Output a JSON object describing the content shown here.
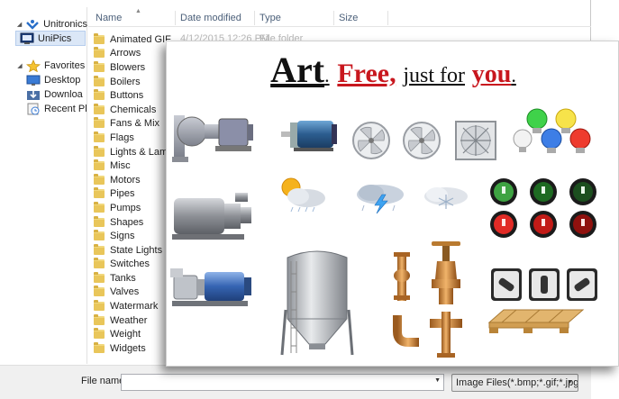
{
  "nav": {
    "items": [
      {
        "label": "Unitronics",
        "icon": "network-icon"
      },
      {
        "label": "UniPics",
        "icon": "monitor-icon"
      },
      {
        "label": "Favorites",
        "icon": "star-icon"
      },
      {
        "label": "Desktop",
        "icon": "desktop-icon"
      },
      {
        "label": "Downloa",
        "icon": "downloads-icon"
      },
      {
        "label": "Recent Pl",
        "icon": "recent-places-icon"
      }
    ]
  },
  "columns": {
    "name": "Name",
    "date_modified": "Date modified",
    "type": "Type",
    "size": "Size"
  },
  "first_row_detail": {
    "date": "4/12/2015 12:26 PM",
    "type": "File folder"
  },
  "folders": [
    "Animated GIF",
    "Arrows",
    "Blowers",
    "Boilers",
    "Buttons",
    "Chemicals",
    "Fans & Mix",
    "Flags",
    "Lights & Lamp",
    "Misc",
    "Motors",
    "Pipes",
    "Pumps",
    "Shapes",
    "Signs",
    "State Lights",
    "Switches",
    "Tanks",
    "Valves",
    "Watermark",
    "Weather",
    "Weight",
    "Widgets"
  ],
  "bottom": {
    "file_name_label": "File name:",
    "file_name_value": "",
    "file_type": "Image Files(*.bmp;*.gif;*.jpg;*.j"
  },
  "preview": {
    "headline": {
      "art": "Art",
      "dot1": ".",
      "free": "Free,",
      "just_for": "just for",
      "you": "you",
      "dot2": "."
    },
    "colors": {
      "red": "#c8171e",
      "black": "#111111"
    }
  }
}
